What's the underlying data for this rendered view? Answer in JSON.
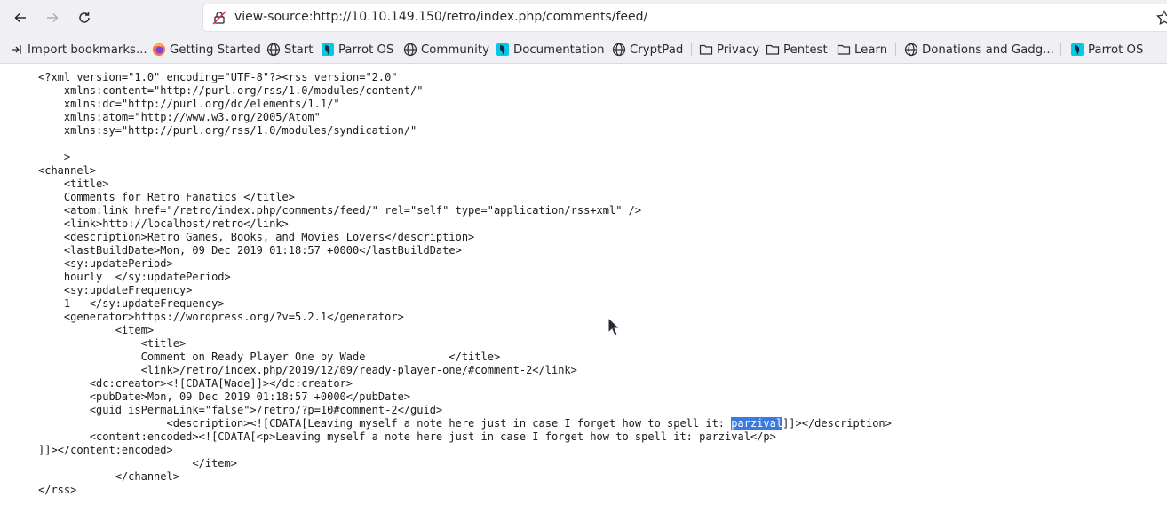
{
  "toolbar": {
    "url": "view-source:http://10.10.149.150/retro/index.php/comments/feed/"
  },
  "bookmarks": [
    {
      "label": "Import bookmarks...",
      "icon": "import-icon"
    },
    {
      "label": "Getting Started",
      "icon": "firefox-icon"
    },
    {
      "label": "Start",
      "icon": "globe-icon"
    },
    {
      "label": "Parrot OS",
      "icon": "parrot-icon"
    },
    {
      "label": "Community",
      "icon": "globe-icon"
    },
    {
      "label": "Documentation",
      "icon": "parrot-icon"
    },
    {
      "label": "CryptPad",
      "icon": "globe-icon"
    },
    {
      "label": "Privacy",
      "icon": "folder-icon"
    },
    {
      "label": "Pentest",
      "icon": "folder-icon"
    },
    {
      "label": "Learn",
      "icon": "folder-icon"
    },
    {
      "label": "Donations and Gadg...",
      "icon": "globe-icon"
    },
    {
      "label": "Parrot OS",
      "icon": "parrot-icon"
    }
  ],
  "source": {
    "lines": [
      "<?xml version=\"1.0\" encoding=\"UTF-8\"?><rss version=\"2.0\"",
      "    xmlns:content=\"http://purl.org/rss/1.0/modules/content/\"",
      "    xmlns:dc=\"http://purl.org/dc/elements/1.1/\"",
      "    xmlns:atom=\"http://www.w3.org/2005/Atom\"",
      "    xmlns:sy=\"http://purl.org/rss/1.0/modules/syndication/\"",
      "",
      "    >",
      "<channel>",
      "    <title>",
      "    Comments for Retro Fanatics </title>",
      "    <atom:link href=\"/retro/index.php/comments/feed/\" rel=\"self\" type=\"application/rss+xml\" />",
      "    <link>http://localhost/retro</link>",
      "    <description>Retro Games, Books, and Movies Lovers</description>",
      "    <lastBuildDate>Mon, 09 Dec 2019 01:18:57 +0000</lastBuildDate>",
      "    <sy:updatePeriod>",
      "    hourly  </sy:updatePeriod>",
      "    <sy:updateFrequency>",
      "    1   </sy:updateFrequency>",
      "    <generator>https://wordpress.org/?v=5.2.1</generator>",
      "            <item>",
      "                <title>",
      "                Comment on Ready Player One by Wade             </title>",
      "                <link>/retro/index.php/2019/12/09/ready-player-one/#comment-2</link>",
      "        <dc:creator><![CDATA[Wade]]></dc:creator>",
      "        <pubDate>Mon, 09 Dec 2019 01:18:57 +0000</pubDate>",
      "        <guid isPermaLink=\"false\">/retro/?p=10#comment-2</guid>",
      "",
      "        <content:encoded><![CDATA[<p>Leaving myself a note here just in case I forget how to spell it: parzival</p>",
      "]]></content:encoded>",
      "                        </item>",
      "            </channel>",
      "</rss>"
    ],
    "desc_line_start": "                    <description><![CDATA[Leaving myself a note here just in case I forget how to spell it: ",
    "desc_line_selected": "parzival",
    "desc_line_end": "]]></description>"
  }
}
